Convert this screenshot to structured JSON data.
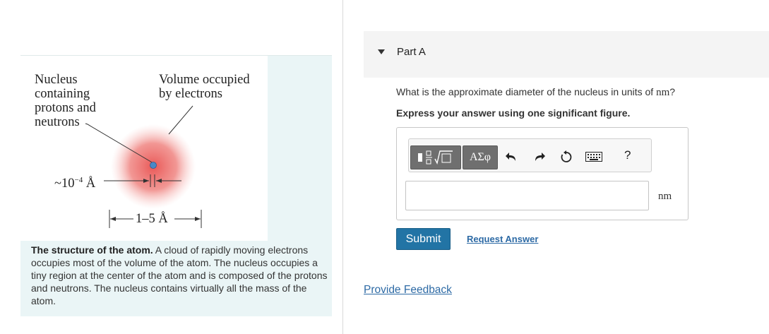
{
  "figure": {
    "label_nucleus": "Nucleus\ncontaining\nprotons and\nneutrons",
    "label_volume": "Volume occupied\nby electrons",
    "label_nucleus_size": "~10",
    "label_nucleus_size_exp": "−4",
    "label_nucleus_size_unit": " Å",
    "label_atom_size": "1–5 Å",
    "caption_bold": "The structure of the atom.",
    "caption_text": " A cloud of rapidly moving electrons occupies most of the volume of the atom. The nucleus occupies a tiny region at the center of the atom and is composed of the protons and neutrons. The nucleus contains virtually all the mass of the atom.",
    "colors": {
      "cloud": "#e8504f",
      "nucleus": "#4a88c8",
      "panel": "#eaf5f6"
    }
  },
  "part": {
    "title": "Part A"
  },
  "question": {
    "text": "What is the approximate diameter of the nucleus in units of ",
    "unit": "nm",
    "suffix": "?",
    "instruction": "Express your answer using one significant figure."
  },
  "toolbar": {
    "greek_label": "ΑΣφ",
    "help_label": "?",
    "icons": [
      "template-icon",
      "undo-icon",
      "redo-icon",
      "reset-icon",
      "keyboard-icon",
      "help-icon"
    ]
  },
  "answer": {
    "value": "",
    "unit": "nm"
  },
  "actions": {
    "submit_label": "Submit",
    "request_label": "Request Answer",
    "feedback_label": "Provide Feedback"
  },
  "colors": {
    "accent": "#2274a5",
    "link": "#2d6aa5"
  }
}
